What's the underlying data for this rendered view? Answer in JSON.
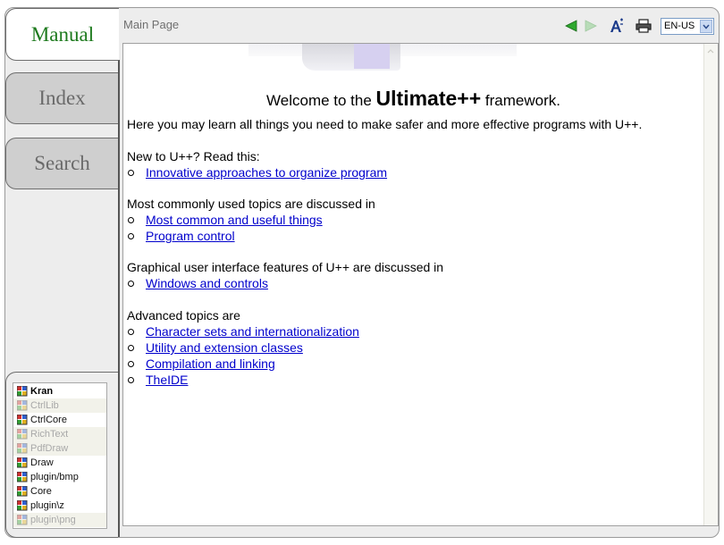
{
  "tabs": [
    {
      "label": "Manual",
      "active": true
    },
    {
      "label": "Index",
      "active": false
    },
    {
      "label": "Search",
      "active": false
    }
  ],
  "header": {
    "page_label": "Main Page",
    "language": "EN-US"
  },
  "content": {
    "welcome_prefix": "Welcome to the",
    "welcome_brand": "Ultimate++",
    "welcome_suffix": "framework.",
    "intro": "Here you may learn all things you need to make safer and more effective programs with U++.",
    "sections": [
      {
        "heading": "New to U++? Read this:",
        "links": [
          "Innovative approaches to organize program"
        ]
      },
      {
        "heading": "Most commonly used topics are discussed in",
        "links": [
          "Most common and useful things",
          "Program control"
        ]
      },
      {
        "heading": "Graphical user interface features of U++ are discussed in",
        "links": [
          "Windows and controls"
        ]
      },
      {
        "heading": "Advanced topics are",
        "links": [
          "Character sets and internationalization",
          "Utility and extension classes",
          "Compilation and linking",
          "TheIDE"
        ]
      }
    ]
  },
  "packages": [
    {
      "name": "Kran",
      "state": "bold"
    },
    {
      "name": "CtrlLib",
      "state": "dim"
    },
    {
      "name": "CtrlCore",
      "state": "normal"
    },
    {
      "name": "RichText",
      "state": "dim"
    },
    {
      "name": "PdfDraw",
      "state": "dim"
    },
    {
      "name": "Draw",
      "state": "normal"
    },
    {
      "name": "plugin/bmp",
      "state": "normal"
    },
    {
      "name": "Core",
      "state": "normal"
    },
    {
      "name": "plugin\\z",
      "state": "normal"
    },
    {
      "name": "plugin\\png",
      "state": "dim"
    }
  ],
  "icons": {
    "back": "arrow-left-icon",
    "forward": "arrow-right-icon",
    "font": "font-size-icon",
    "print": "printer-icon",
    "package": "package-icon"
  },
  "colors": {
    "active_tab_text": "#1d7a1d",
    "link": "#0000cc",
    "back_arrow": "#2fa82f"
  }
}
